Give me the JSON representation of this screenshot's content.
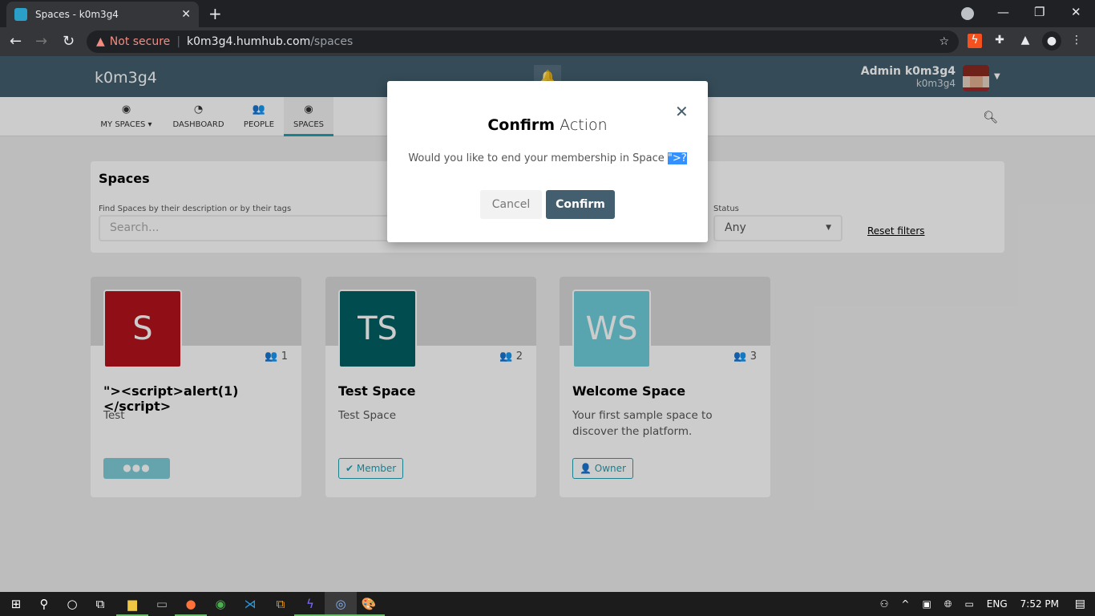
{
  "browser": {
    "tab_title": "Spaces - k0m3g4",
    "url_warning": "Not secure",
    "url_host": "k0m3g4.humhub.com",
    "url_path": "/spaces"
  },
  "header": {
    "brand": "k0m3g4",
    "user_name": "Admin k0m3g4",
    "user_sub": "k0m3g4"
  },
  "nav": [
    {
      "label": "MY SPACES ▾",
      "icon": "◉"
    },
    {
      "label": "DASHBOARD",
      "icon": "◔"
    },
    {
      "label": "PEOPLE",
      "icon": "👥"
    },
    {
      "label": "SPACES",
      "icon": "◉"
    }
  ],
  "panel": {
    "title": "Spaces",
    "search_label": "Find Spaces by their description or by their tags",
    "search_placeholder": "Search...",
    "status_label": "Status",
    "status_value": "Any",
    "reset": "Reset filters"
  },
  "cards": [
    {
      "initials": "S",
      "color": "#b5121b",
      "members": "1",
      "title": "\"><script>alert(1)</script>",
      "desc": "Test",
      "badge": "●●●"
    },
    {
      "initials": "TS",
      "color": "#005f63",
      "members": "2",
      "title": "Test Space",
      "desc": "Test Space",
      "badge": "✔ Member"
    },
    {
      "initials": "WS",
      "color": "#6fcfdd",
      "members": "3",
      "title": "Welcome Space",
      "desc": "Your first sample space to discover the platform.",
      "badge": "👤 Owner"
    }
  ],
  "modal": {
    "title_bold": "Confirm",
    "title_rest": "Action",
    "body": "Would you like to end your membership in Space",
    "highlight": "\">?",
    "cancel": "Cancel",
    "confirm": "Confirm"
  },
  "taskbar": {
    "lang": "ENG",
    "time": "7:52 PM"
  }
}
